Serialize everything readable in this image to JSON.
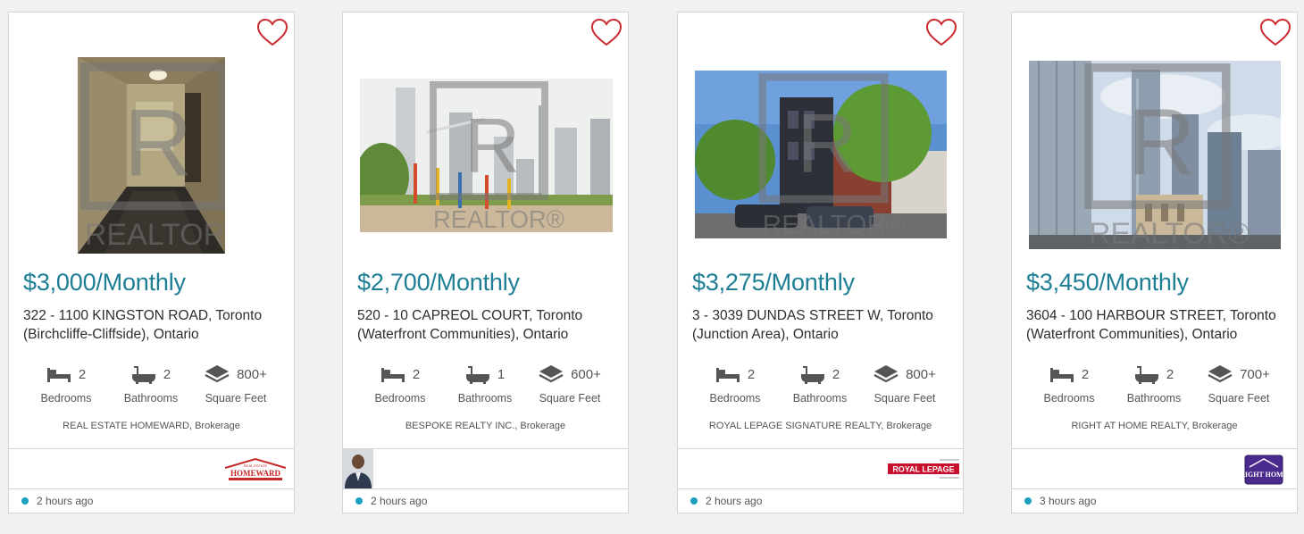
{
  "listings": [
    {
      "price": "$3,000/Monthly",
      "address_line1": "322 - 1100 KINGSTON ROAD, Toronto",
      "address_line2": "(Birchcliffe-Cliffside), Ontario",
      "bedrooms": "2",
      "bathrooms": "2",
      "sqft": "800+",
      "brokerage": "REAL ESTATE HOMEWARD, Brokerage",
      "logo_text": "HOMEWARD",
      "logo_small_text": "REAL ESTATE",
      "posted": "2 hours ago"
    },
    {
      "price": "$2,700/Monthly",
      "address_line1": "520 - 10 CAPREOL COURT, Toronto",
      "address_line2": "(Waterfront Communities), Ontario",
      "bedrooms": "2",
      "bathrooms": "1",
      "sqft": "600+",
      "brokerage": "BESPOKE REALTY INC., Brokerage",
      "posted": "2 hours ago"
    },
    {
      "price": "$3,275/Monthly",
      "address_line1": "3 - 3039 DUNDAS STREET W, Toronto",
      "address_line2": "(Junction Area), Ontario",
      "bedrooms": "2",
      "bathrooms": "2",
      "sqft": "800+",
      "brokerage": "ROYAL LEPAGE SIGNATURE REALTY, Brokerage",
      "logo_text": "ROYAL LEPAGE",
      "posted": "2 hours ago"
    },
    {
      "price": "$3,450/Monthly",
      "address_line1": "3604 - 100 HARBOUR STREET, Toronto",
      "address_line2": "(Waterfront Communities), Ontario",
      "bedrooms": "2",
      "bathrooms": "2",
      "sqft": "700+",
      "brokerage": "RIGHT AT HOME REALTY, Brokerage",
      "logo_text": "RIGHT HOME",
      "posted": "3 hours ago"
    }
  ],
  "labels": {
    "bedrooms": "Bedrooms",
    "bathrooms": "Bathrooms",
    "sqft": "Square Feet"
  },
  "photo_watermark": "REALTOR®",
  "colors": {
    "price": "#1d7e95",
    "heart": "#cc2a2f",
    "status_dot": "#1d9fc0",
    "icons": "#555555"
  }
}
